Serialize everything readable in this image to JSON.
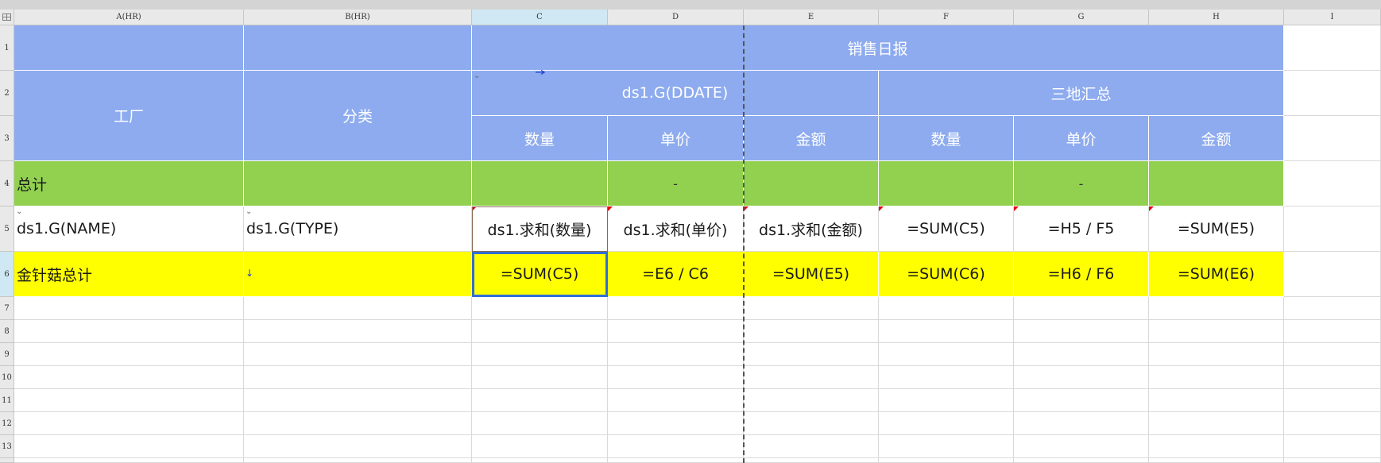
{
  "columns": {
    "A": "A(HR)",
    "B": "B(HR)",
    "C": "C",
    "D": "D",
    "E": "E",
    "F": "F",
    "G": "G",
    "H": "H",
    "I": "I"
  },
  "rows": {
    "r1": "1",
    "r2": "2",
    "r3": "3",
    "r4": "4",
    "r5": "5",
    "r6": "6",
    "r7": "7",
    "r8": "8",
    "r9": "9",
    "r10": "10",
    "r11": "11",
    "r12": "12",
    "r13": "13"
  },
  "header": {
    "title": "销售日报",
    "factory": "工厂",
    "category": "分类",
    "date_group": "ds1.G(DDATE)",
    "three_site_summary": "三地汇总",
    "qty": "数量",
    "price": "单价",
    "amount": "金额"
  },
  "total_row": {
    "label": "总计",
    "d_value": "-",
    "g_value": "-"
  },
  "detail_row": {
    "a": "ds1.G(NAME)",
    "b": "ds1.G(TYPE)",
    "c": "ds1.求和(数量)",
    "d": "ds1.求和(单价)",
    "e": "ds1.求和(金额)",
    "f": "=SUM(C5)",
    "g": "=H5 / F5",
    "h": "=SUM(E5)"
  },
  "subtotal_row": {
    "a": "金针菇总计",
    "c": "=SUM(C5)",
    "d": "=E6 / C6",
    "e": "=SUM(E5)",
    "f": "=SUM(C6)",
    "g": "=H6 / F6",
    "h": "=SUM(E6)"
  },
  "colors": {
    "header_blue": "#8dabee",
    "total_green": "#92d050",
    "subtotal_yellow": "#ffff00",
    "selection_blue": "#2f6fd6",
    "marker_red": "#e8000b"
  },
  "selected_cell": "C6"
}
